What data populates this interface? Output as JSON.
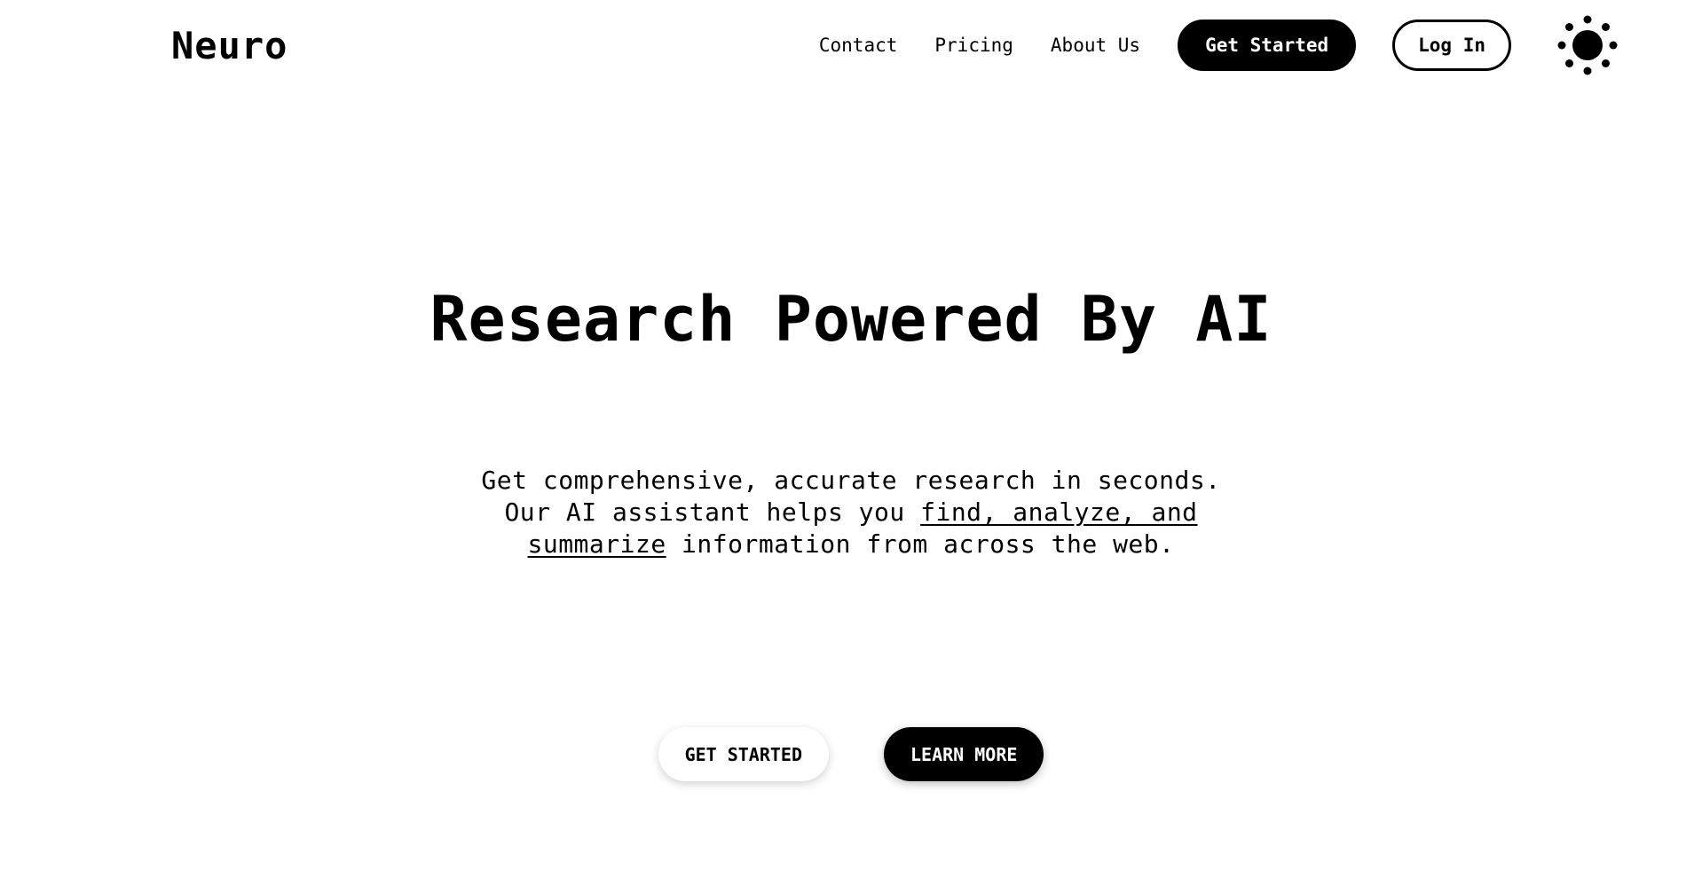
{
  "header": {
    "brand": "Neuro",
    "nav": {
      "contact": "Contact",
      "pricing": "Pricing",
      "about": "About Us"
    },
    "get_started": "Get Started",
    "log_in": "Log In",
    "theme_icon": "sun-icon"
  },
  "hero": {
    "title": "Research Powered By AI",
    "subtitle_before": "Get comprehensive, accurate research in seconds. Our AI assistant helps you ",
    "subtitle_link": "find, analyze, and summarize",
    "subtitle_after": " information from across the web.",
    "cta_primary": "GET STARTED",
    "cta_secondary": "LEARN MORE"
  },
  "colors": {
    "background": "#ffffff",
    "foreground": "#000000"
  }
}
